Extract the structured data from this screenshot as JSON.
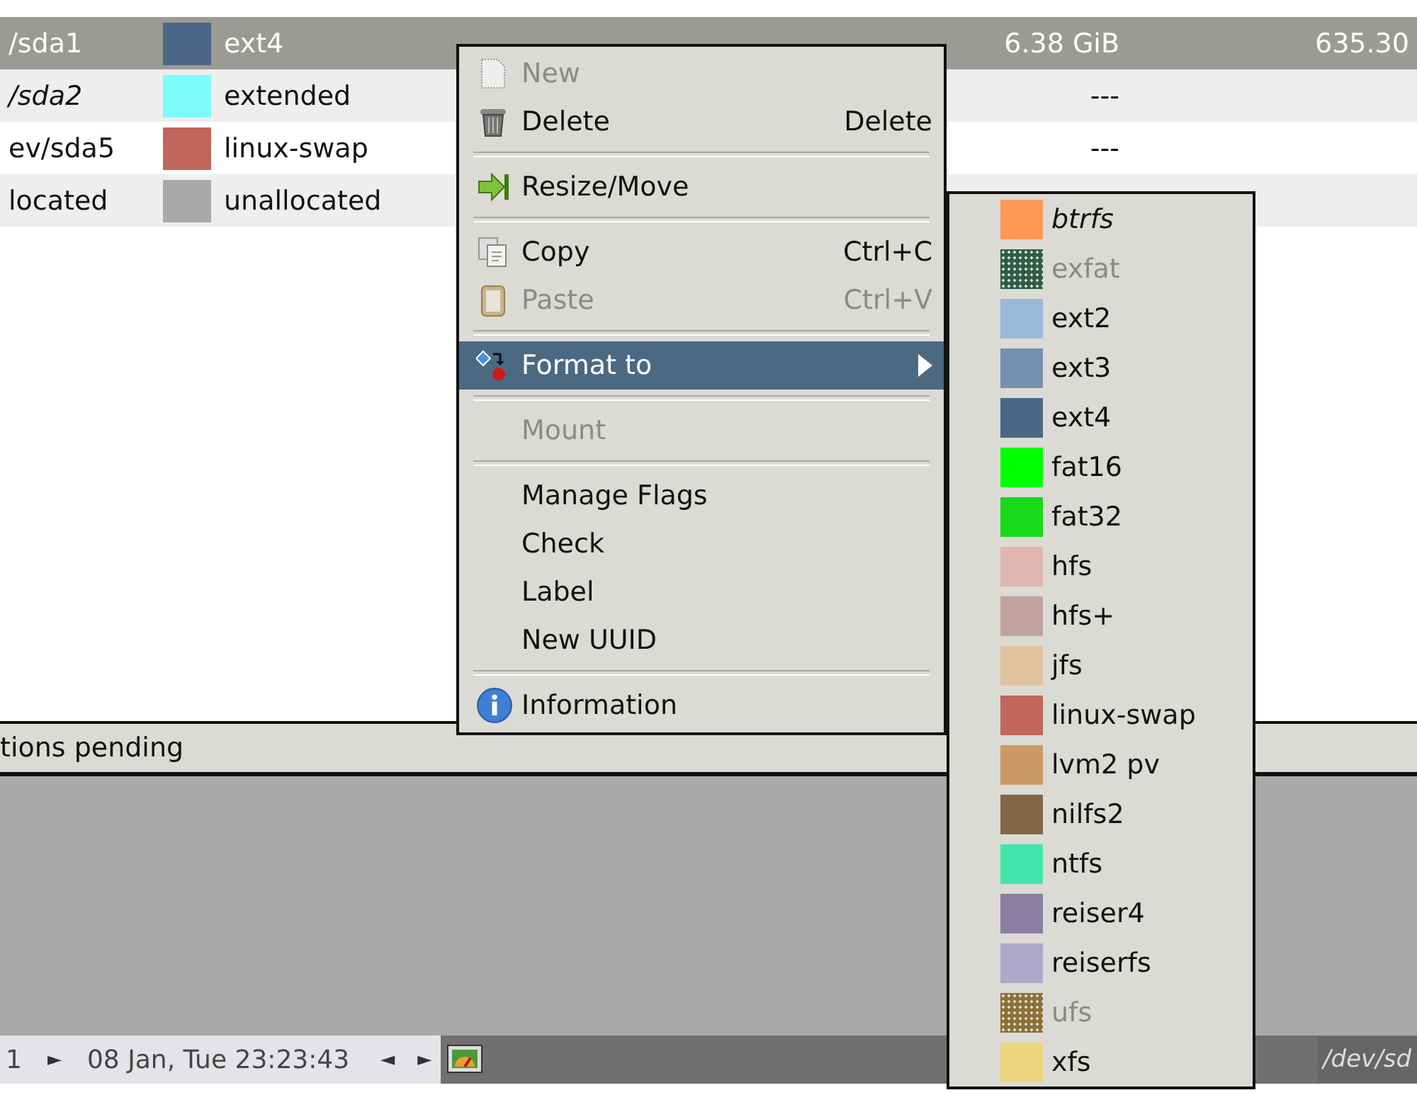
{
  "table": {
    "rows": [
      {
        "partition": "/sda1",
        "filesystem": "ext4",
        "color": "#4a6785",
        "used": "6.38 GiB",
        "unused": "635.30",
        "selected": true,
        "italic": false
      },
      {
        "partition": "/sda2",
        "filesystem": "extended",
        "color": "#7dfcfe",
        "used": "---",
        "selected": false,
        "italic": true
      },
      {
        "partition": "ev/sda5",
        "filesystem": "linux-swap",
        "color": "#c1665a",
        "used": "---",
        "selected": false,
        "italic": false
      },
      {
        "partition": "located",
        "filesystem": "unallocated",
        "color": "#a9a9a9",
        "selected": false,
        "italic": false
      }
    ]
  },
  "status_bar": {
    "text": "tions pending"
  },
  "taskbar": {
    "desktop": "1",
    "next": "►",
    "clock": "08 Jan, Tue 23:23:43",
    "prev_task": "◄",
    "next_task": "►",
    "window_title": "/dev/sd"
  },
  "context_menu": {
    "items": [
      {
        "kind": "item",
        "label": "New",
        "disabled": true,
        "selected": false
      },
      {
        "kind": "item",
        "label": "Delete",
        "shortcut": "Delete",
        "disabled": false,
        "selected": false
      },
      {
        "kind": "separator"
      },
      {
        "kind": "item",
        "label": "Resize/Move",
        "disabled": false,
        "selected": false
      },
      {
        "kind": "separator"
      },
      {
        "kind": "item",
        "label": "Copy",
        "shortcut": "Ctrl+C",
        "disabled": false,
        "selected": false
      },
      {
        "kind": "item",
        "label": "Paste",
        "shortcut": "Ctrl+V",
        "disabled": true,
        "selected": false
      },
      {
        "kind": "separator"
      },
      {
        "kind": "submenu",
        "label": "Format to",
        "disabled": false,
        "selected": true
      },
      {
        "kind": "separator"
      },
      {
        "kind": "item",
        "label": "Mount",
        "disabled": true,
        "selected": false
      },
      {
        "kind": "separator"
      },
      {
        "kind": "item",
        "label": "Manage Flags",
        "disabled": false,
        "selected": false
      },
      {
        "kind": "item",
        "label": "Check",
        "disabled": false,
        "selected": false
      },
      {
        "kind": "item",
        "label": "Label",
        "disabled": false,
        "selected": false
      },
      {
        "kind": "item",
        "label": "New UUID",
        "disabled": false,
        "selected": false
      },
      {
        "kind": "separator"
      },
      {
        "kind": "item",
        "label": "Information",
        "disabled": false,
        "selected": false
      }
    ]
  },
  "format_submenu": {
    "items": [
      {
        "label": "btrfs",
        "color": "#ff9955",
        "disabled": false,
        "italic": true
      },
      {
        "label": "exfat",
        "color": "#2e5e4a",
        "disabled": true,
        "italic": false
      },
      {
        "label": "ext2",
        "color": "#9ab8d7",
        "disabled": false,
        "italic": false
      },
      {
        "label": "ext3",
        "color": "#7590ae",
        "disabled": false,
        "italic": false
      },
      {
        "label": "ext4",
        "color": "#4a6785",
        "disabled": false,
        "italic": false
      },
      {
        "label": "fat16",
        "color": "#00ff00",
        "disabled": false,
        "italic": false
      },
      {
        "label": "fat32",
        "color": "#18d918",
        "disabled": false,
        "italic": false
      },
      {
        "label": "hfs",
        "color": "#e0b6af",
        "disabled": false,
        "italic": false
      },
      {
        "label": "hfs+",
        "color": "#c0a39e",
        "disabled": false,
        "italic": false
      },
      {
        "label": "jfs",
        "color": "#e0c39e",
        "disabled": false,
        "italic": false
      },
      {
        "label": "linux-swap",
        "color": "#c1665a",
        "disabled": false,
        "italic": false
      },
      {
        "label": "lvm2 pv",
        "color": "#cc9966",
        "disabled": false,
        "italic": false
      },
      {
        "label": "nilfs2",
        "color": "#826647",
        "disabled": false,
        "italic": false
      },
      {
        "label": "ntfs",
        "color": "#42e5ac",
        "disabled": false,
        "italic": false
      },
      {
        "label": "reiser4",
        "color": "#887fa3",
        "disabled": false,
        "italic": false
      },
      {
        "label": "reiserfs",
        "color": "#ada7c8",
        "disabled": false,
        "italic": false
      },
      {
        "label": "ufs",
        "color": "#8d7136",
        "disabled": true,
        "italic": false
      },
      {
        "label": "xfs",
        "color": "#eed680",
        "disabled": false,
        "italic": false
      }
    ]
  }
}
